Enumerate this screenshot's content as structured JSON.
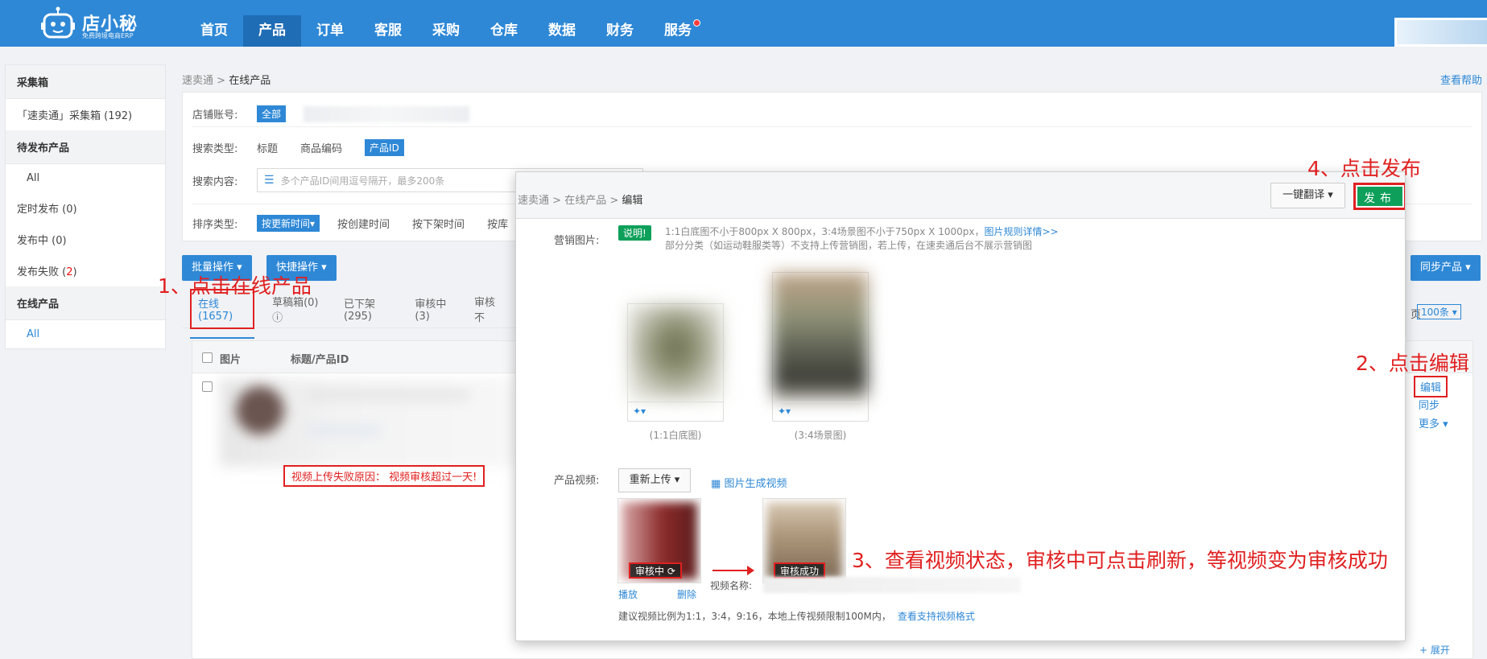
{
  "app": {
    "logo_text": "店小秘",
    "logo_sub": "免费跨境电商ERP",
    "nav": [
      {
        "label": "首页"
      },
      {
        "label": "产品",
        "active": true
      },
      {
        "label": "订单"
      },
      {
        "label": "客服"
      },
      {
        "label": "采购"
      },
      {
        "label": "仓库"
      },
      {
        "label": "数据"
      },
      {
        "label": "财务"
      },
      {
        "label": "服务",
        "dot": true
      }
    ]
  },
  "sidebar": {
    "sections": [
      {
        "title": "采集箱",
        "items": [
          {
            "label": "「速卖通」采集箱 (192)"
          }
        ]
      },
      {
        "title": "待发布产品",
        "items": [
          {
            "label": "All",
            "indent": true
          },
          {
            "label": "定时发布 (0)"
          },
          {
            "label": "发布中 (0)"
          },
          {
            "label": "发布失败 (",
            "count": "2",
            "suffix": ")"
          }
        ]
      },
      {
        "title": "在线产品",
        "items": [
          {
            "label": "All",
            "indent": true,
            "active": true
          }
        ]
      }
    ]
  },
  "breadcrumb": {
    "root": "速卖通",
    "sep": ">",
    "current": "在线产品"
  },
  "help_link": "查看帮助",
  "filters": {
    "account_label": "店铺账号:",
    "account_all": "全部",
    "search_type_label": "搜索类型:",
    "search_types": [
      "标题",
      "商品编码"
    ],
    "search_type_active": "产品ID",
    "content_label": "搜索内容:",
    "content_placeholder": "多个产品ID间用逗号隔开，最多200条",
    "sort_label": "排序类型:",
    "sort_active": "按更新时间▾",
    "sort_options": [
      "按创建时间",
      "按下架时间",
      "按库"
    ]
  },
  "toolbar": {
    "batch": "批量操作 ▾",
    "quick": "快捷操作 ▾",
    "sync_products": "同步产品 ▾",
    "page_size": "100条 ▾",
    "page_prefix": "页"
  },
  "tabs": [
    {
      "label": "在线(1657)",
      "active": true
    },
    {
      "label": "草稿箱(0)"
    },
    {
      "label": "已下架(295)"
    },
    {
      "label": "审核中(3)"
    },
    {
      "label": "审核不"
    }
  ],
  "table": {
    "col_image": "图片",
    "col_title": "标题/产品ID",
    "actions": [
      "编辑",
      "同步",
      "更多 ▾"
    ],
    "expand": "+ 展开"
  },
  "fail_reason": "视频上传失败原因： 视频审核超过一天!",
  "annotations": {
    "step1": "1、点击在线产品",
    "step2": "2、点击编辑",
    "step3": "3、查看视频状态，审核中可点击刷新，等视频变为审核成功",
    "step4": "4、点击发布"
  },
  "modal": {
    "breadcrumb": {
      "a": "速卖通",
      "b": "在线产品",
      "c": "编辑"
    },
    "translate_btn": "一键翻译 ▾",
    "publish_btn": "发布",
    "marketing_label": "营销图片:",
    "note_tag": "说明!",
    "note_line1": "1:1白底图不小于800px X 800px，3:4场景图不小于750px X 1000px，",
    "note_link": "图片规则详情>>",
    "note_line2": "部分分类（如运动鞋服类等）不支持上传营销图，若上传，在速卖通后台不展示营销图",
    "img1_caption": "(1:1白底图)",
    "img2_caption": "(3:4场景图)",
    "video_label": "产品视频:",
    "reupload": "重新上传 ▾",
    "gen_video": "图片生成视频",
    "status_reviewing": "审核中",
    "status_success": "审核成功",
    "play": "播放",
    "delete": "删除",
    "video_name_label": "视频名称:",
    "video_tip": "建议视频比例为1:1，3:4，9:16，本地上传视频限制100M内，",
    "video_tip_link": "查看支持视频格式"
  }
}
